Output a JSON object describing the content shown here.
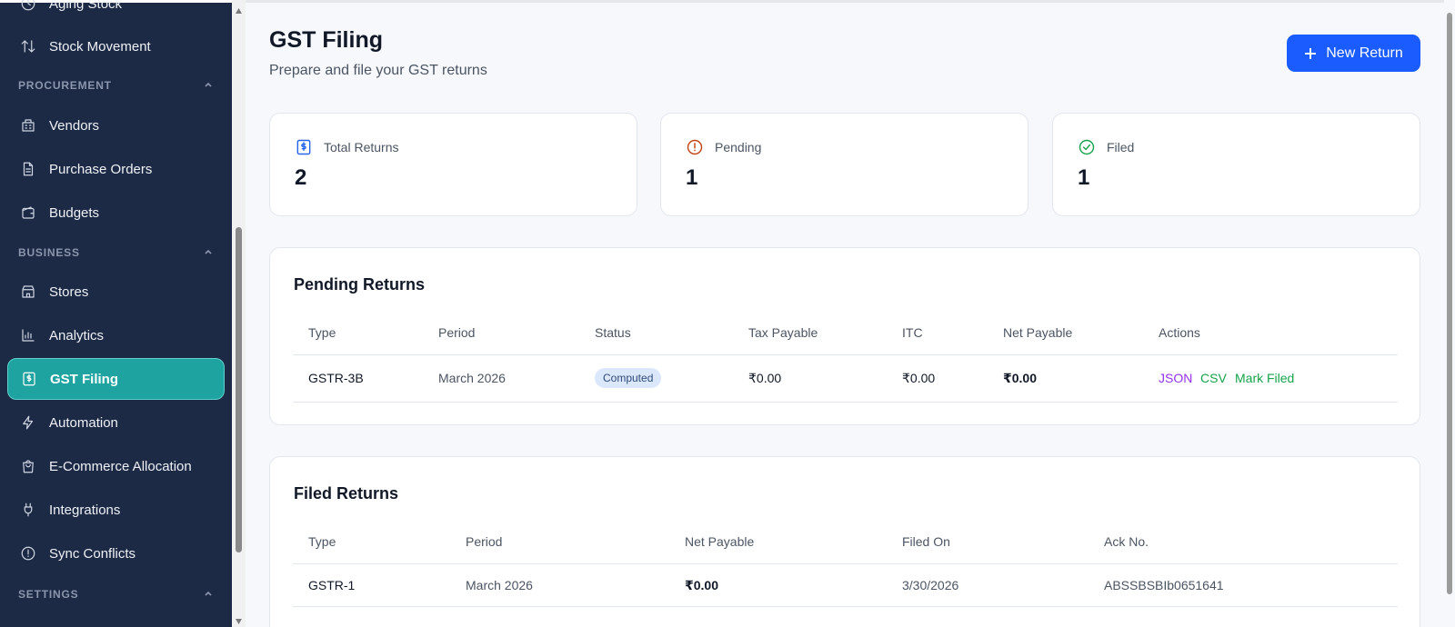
{
  "sidebar": {
    "items": [
      {
        "label": "Aging Stock",
        "icon": "clock-icon"
      },
      {
        "label": "Stock Movement",
        "icon": "arrows-updown-icon"
      },
      {
        "label": "Vendors",
        "icon": "building-icon"
      },
      {
        "label": "Purchase Orders",
        "icon": "document-icon"
      },
      {
        "label": "Budgets",
        "icon": "wallet-icon"
      },
      {
        "label": "Stores",
        "icon": "store-icon"
      },
      {
        "label": "Analytics",
        "icon": "bar-chart-icon"
      },
      {
        "label": "GST Filing",
        "icon": "receipt-icon",
        "active": true
      },
      {
        "label": "Automation",
        "icon": "lightning-icon"
      },
      {
        "label": "E-Commerce Allocation",
        "icon": "shopping-bag-icon"
      },
      {
        "label": "Integrations",
        "icon": "plug-icon"
      },
      {
        "label": "Sync Conflicts",
        "icon": "alert-circle-icon"
      }
    ],
    "sections": [
      "PROCUREMENT",
      "BUSINESS",
      "SETTINGS"
    ]
  },
  "header": {
    "title": "GST Filing",
    "subtitle": "Prepare and file your GST returns",
    "new_button": "New Return"
  },
  "stats": [
    {
      "label": "Total Returns",
      "value": "2",
      "icon": "receipt-icon",
      "color": "#2563eb"
    },
    {
      "label": "Pending",
      "value": "1",
      "icon": "alert-circle-icon",
      "color": "#c2410c"
    },
    {
      "label": "Filed",
      "value": "1",
      "icon": "check-circle-icon",
      "color": "#16a34a"
    }
  ],
  "pending": {
    "title": "Pending Returns",
    "columns": [
      "Type",
      "Period",
      "Status",
      "Tax Payable",
      "ITC",
      "Net Payable",
      "Actions"
    ],
    "rows": [
      {
        "type": "GSTR-3B",
        "period": "March 2026",
        "status": "Computed",
        "tax_payable": "₹0.00",
        "itc": "₹0.00",
        "net_payable": "₹0.00",
        "actions": [
          "JSON",
          "CSV",
          "Mark Filed"
        ]
      }
    ]
  },
  "filed": {
    "title": "Filed Returns",
    "columns": [
      "Type",
      "Period",
      "Net Payable",
      "Filed On",
      "Ack No."
    ],
    "rows": [
      {
        "type": "GSTR-1",
        "period": "March 2026",
        "net_payable": "₹0.00",
        "filed_on": "3/30/2026",
        "ack_no": "ABSSBSBIb0651641"
      }
    ]
  },
  "colors": {
    "sidebar_bg": "#1d2a45",
    "active_item": "#1fa3a0",
    "primary": "#1a5cff",
    "json_action": "#9333ea",
    "csv_action": "#16a34a",
    "mark_filed_action": "#16a34a"
  }
}
